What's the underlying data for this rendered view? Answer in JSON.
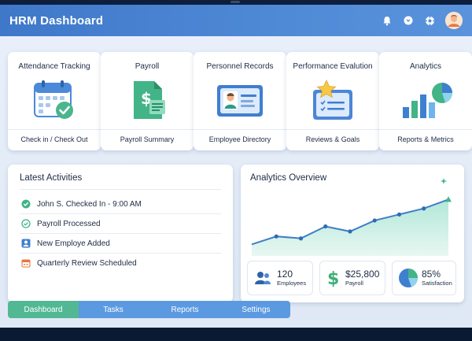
{
  "app": {
    "title": "HRM Dashboard"
  },
  "header": {
    "icons": [
      "bell-icon",
      "chat-icon",
      "settings-icon",
      "avatar"
    ]
  },
  "cards": [
    {
      "title": "Attendance Tracking",
      "footer": "Check in / Check Out",
      "icon": "calendar-check-icon"
    },
    {
      "title": "Payroll",
      "footer": "Payroll Summary",
      "icon": "dollar-document-icon"
    },
    {
      "title": "Personnel Records",
      "footer": "Employee Directory",
      "icon": "id-card-icon"
    },
    {
      "title": "Performance Evalution",
      "footer": "Reviews & Goals",
      "icon": "star-checklist-icon"
    },
    {
      "title": "Analytics",
      "footer": "Reports & Metrics",
      "icon": "bar-pie-chart-icon"
    }
  ],
  "activities": {
    "title": "Latest Activities",
    "items": [
      {
        "text": "John S. Checked In - 9:00 AM",
        "icon": "check-circle-icon"
      },
      {
        "text": "Payroll Processed",
        "icon": "check-outline-icon"
      },
      {
        "text": "New Employe Added",
        "icon": "user-add-icon"
      },
      {
        "text": "Quarterly Review Scheduled",
        "icon": "calendar-icon"
      }
    ]
  },
  "analytics": {
    "title": "Analytics Overview",
    "stats": [
      {
        "value": "120",
        "label": "Employees",
        "icon": "people-icon"
      },
      {
        "value": "$25,800",
        "label": "Payroll",
        "icon": "dollar-icon"
      },
      {
        "value": "85%",
        "label": "Satisfaction",
        "icon": "pie-chart-icon"
      }
    ]
  },
  "chart_data": {
    "type": "area",
    "x": [
      1,
      2,
      3,
      4,
      5,
      6,
      7,
      8,
      9
    ],
    "values": [
      10,
      18,
      16,
      28,
      23,
      34,
      40,
      46,
      55
    ],
    "ylim": [
      0,
      60
    ],
    "grid": false
  },
  "tabs": [
    {
      "label": "Dashboard",
      "active": true
    },
    {
      "label": "Tasks",
      "active": false
    },
    {
      "label": "Reports",
      "active": false
    },
    {
      "label": "Settings",
      "active": false
    }
  ],
  "colors": {
    "header": "#4f8ad6",
    "accent_green": "#52b894",
    "tab_blue": "#5b9ae0",
    "chart_line": "#3d7fc6",
    "chart_fill": "#bfe9de"
  }
}
